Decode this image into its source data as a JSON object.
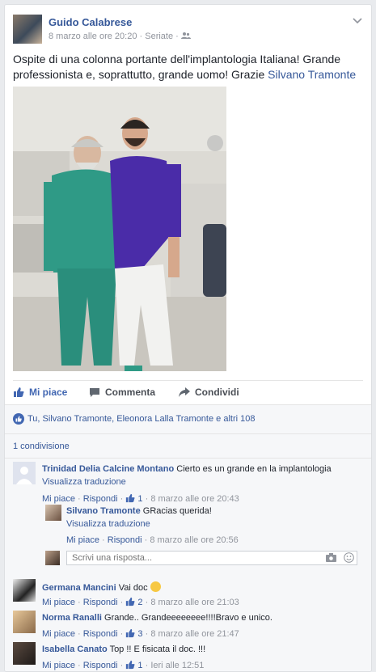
{
  "post": {
    "author": "Guido Calabrese",
    "timestamp": "8 marzo alle ore 20:20",
    "separator": " · ",
    "audience": "Seriate",
    "separator2": " · ",
    "text_prefix": "Ospite di una colonna portante dell'implantologia Italiana! Grande professionista e, soprattutto, grande uomo! Grazie ",
    "text_tag": "Silvano Tramonte"
  },
  "actions": {
    "like": "Mi piace",
    "comment": "Commenta",
    "share": "Condividi"
  },
  "reactions": {
    "summary": "Tu, Silvano Tramonte, Eleonora Lalla Tramonte e altri 108"
  },
  "shares": {
    "count_text": "1 condivisione"
  },
  "comments": [
    {
      "author": "Trinidad Delia Calcine Montano",
      "text": "Cierto es un grande en la implantologia",
      "translate": "Visualizza traduzione",
      "like": "Mi piace",
      "reply": "Rispondi",
      "likes": "1",
      "time": "8 marzo alle ore 20:43"
    },
    {
      "author": "Silvano Tramonte",
      "text": "GRacias querida!",
      "translate": "Visualizza traduzione",
      "like": "Mi piace",
      "reply": "Rispondi",
      "time": "8 marzo alle ore 20:56"
    },
    {
      "author": "Germana Mancini",
      "text": "Vai doc",
      "like": "Mi piace",
      "reply": "Rispondi",
      "likes": "2",
      "time": "8 marzo alle ore 21:03"
    },
    {
      "author": "Norma Ranalli",
      "text": "Grande.. Grandeeeeeeee!!!!Bravo e unico.",
      "like": "Mi piace",
      "reply": "Rispondi",
      "likes": "3",
      "time": "8 marzo alle ore 21:47"
    },
    {
      "author": "Isabella Canato",
      "text": "Top !! E fisicata il doc. !!!",
      "like": "Mi piace",
      "reply": "Rispondi",
      "likes": "1",
      "time": "Ieri alle 12:51"
    }
  ],
  "reply_box": {
    "placeholder": "Scrivi una risposta..."
  },
  "icons": {
    "chevron": "chevron-down-icon",
    "audience": "friends-icon",
    "like": "thumbs-up-icon",
    "comment": "comment-icon",
    "share": "share-arrow-icon",
    "camera": "camera-icon",
    "emoji": "emoji-icon"
  },
  "colors": {
    "link": "#365899",
    "like_blue": "#4267b2",
    "muted": "#90949c",
    "bg": "#f6f7f9"
  }
}
